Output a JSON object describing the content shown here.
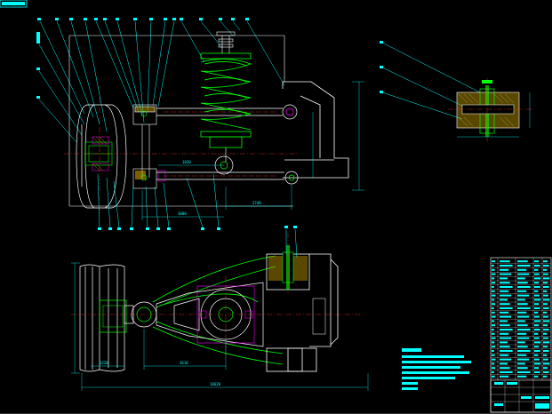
{
  "drawing": {
    "background": "#000000",
    "colors": {
      "outline": "#ffffff",
      "leader": "#00ffff",
      "spring": "#00ff00",
      "section": "#ff00ff",
      "hatch": "#c8a000",
      "center": "#ff3030",
      "title_block": "#00ffff"
    },
    "views": [
      "front-view",
      "top-view",
      "detail-view"
    ],
    "title_block": {
      "label": "title block"
    },
    "notes_block": {
      "label": "technical requirements"
    },
    "dimensions": {
      "dim_front_1": "1820",
      "dim_front_2": "2740",
      "dim_front_3": "3000",
      "dim_top_1": "1220",
      "dim_top_2": "3610",
      "dim_top_overall": "10620"
    }
  }
}
